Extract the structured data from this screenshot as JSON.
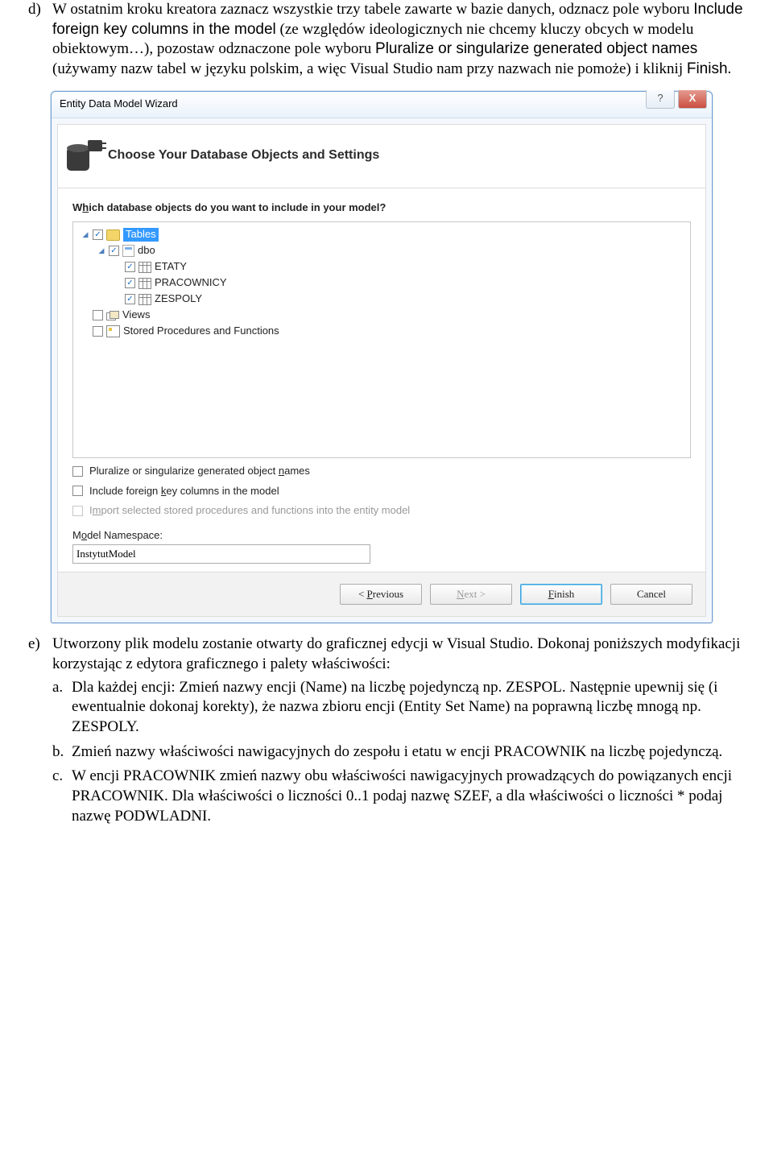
{
  "item_d": {
    "label": "d)",
    "text_before_term1": "W ostatnim kroku kreatora zaznacz wszystkie trzy tabele zawarte w bazie danych, odznacz pole wyboru ",
    "term1": "Include foreign key columns in the model",
    "text_mid1": " (ze względów ideologicznych nie chcemy kluczy obcych w modelu obiektowym…), pozostaw odznaczone pole wyboru ",
    "term2": "Pluralize or singularize generated object names",
    "text_mid2": " (używamy nazw tabel w języku polskim, a więc Visual Studio nam przy nazwach nie pomoże) i kliknij ",
    "term3": "Finish",
    "text_end": "."
  },
  "wizard": {
    "title": "Entity Data Model Wizard",
    "help_glyph": "?",
    "close_glyph": "X",
    "header": "Choose Your Database Objects and Settings",
    "question_pre": "W",
    "question_u": "h",
    "question_post": "ich database objects do you want to include in your model?",
    "tree": {
      "tables": "Tables",
      "dbo": "dbo",
      "t1": "ETATY",
      "t2": "PRACOWNICY",
      "t3": "ZESPOLY",
      "views": "Views",
      "sp": "Stored Procedures and Functions"
    },
    "opt1_pre": "Pluralize or singularize generated object ",
    "opt1_u": "n",
    "opt1_post": "ames",
    "opt2_pre": "Include foreign ",
    "opt2_u": "k",
    "opt2_post": "ey columns in the model",
    "opt3_pre": "I",
    "opt3_u": "m",
    "opt3_post": "port selected stored procedures and functions into the entity model",
    "ns_label_pre": "M",
    "ns_label_u": "o",
    "ns_label_post": "del Namespace:",
    "ns_value": "InstytutModel",
    "btn_prev_pre": "< ",
    "btn_prev_u": "P",
    "btn_prev_post": "revious",
    "btn_next_pre": "",
    "btn_next_u": "N",
    "btn_next_post": "ext >",
    "btn_finish_pre": "",
    "btn_finish_u": "F",
    "btn_finish_post": "inish",
    "btn_cancel": "Cancel"
  },
  "item_e": {
    "label": "e)",
    "text": "Utworzony plik modelu zostanie otwarty do graficznej edycji w Visual Studio. Dokonaj poniższych modyfikacji korzystając z edytora graficznego i palety właściwości:",
    "a": {
      "label": "a.",
      "text": "Dla każdej encji: Zmień nazwy encji (Name) na liczbę pojedynczą np. ZESPOL. Następnie upewnij się (i ewentualnie dokonaj korekty), że nazwa zbioru encji (Entity Set Name) na poprawną liczbę mnogą np. ZESPOLY."
    },
    "b": {
      "label": "b.",
      "text": "Zmień nazwy właściwości nawigacyjnych do zespołu i etatu w encji PRACOWNIK na liczbę pojedynczą."
    },
    "c": {
      "label": "c.",
      "text": "W encji PRACOWNIK zmień nazwy obu właściwości nawigacyjnych prowadzących do powiązanych encji PRACOWNIK. Dla właściwości o liczności 0..1 podaj nazwę SZEF, a dla właściwości o liczności * podaj nazwę PODWLADNI."
    }
  }
}
